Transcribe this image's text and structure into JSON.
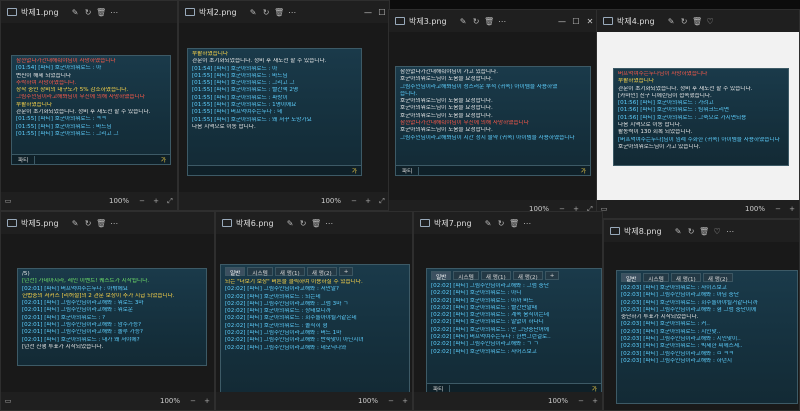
{
  "icons": [
    "photo-app-icon",
    "edit-icon",
    "rotate-icon",
    "delete-icon",
    "more-icon",
    "minimize-icon",
    "maximize-icon",
    "close-icon",
    "fit-icon",
    "zoom-out-icon",
    "zoom-in-icon",
    "fullscreen-icon",
    "heart-icon"
  ],
  "windows": [
    {
      "title": "박제1.png",
      "zoom": "100%",
      "input": "파티",
      "send": "가",
      "lines": [
        {
          "t": "잠깐없다가간대해줘야님이 사망하였습니다",
          "c": "r"
        },
        {
          "t": "[01:54] [파티] 호군아의워로드 : 아",
          "c": "c"
        },
        {
          "t": "변신이 해제 되었습니다",
          "c": "w"
        },
        {
          "t": "추락하여 사망하였습니다.",
          "c": "r"
        },
        {
          "t": "장착 중인 장비의 내구도가 5% 감소하였습니다.",
          "c": "y"
        },
        {
          "t": "그림주인님이라고해봐님이 무진에 의해 사망하였습니다",
          "c": "r"
        },
        {
          "t": "부활하였습니다",
          "c": "y"
        },
        {
          "t": "관문이 초기화되었습니다. 정비 후 재도전 할 수 있습니다.",
          "c": "w"
        },
        {
          "t": "[01:55] [파티] 호군아의워로드 : ㅋㅋ",
          "c": "c"
        },
        {
          "t": "[01:55] [파티] 호군아의워로드 : 바드님",
          "c": "c"
        },
        {
          "t": "[01:55] [파티] 호군아의워로드 : 그리고 그",
          "c": "c"
        }
      ]
    },
    {
      "title": "박제2.png",
      "zoom": "100%",
      "input": "",
      "send": "가",
      "lines": [
        {
          "t": "부활하였습니다",
          "c": "y"
        },
        {
          "t": "관문이 초기화되었습니다. 정비 후 재도전 할 수 있습니다.",
          "c": "w"
        },
        {
          "t": "[01:54] [파티] 호군아의워로드 : 아",
          "c": "c"
        },
        {
          "t": "[01:55] [파티] 호군아의워로드 : 바드님",
          "c": "c"
        },
        {
          "t": "[01:55] [파티] 호군아의워로드 : 그리고 그",
          "c": "c"
        },
        {
          "t": "[01:55] [파티] 호군아의워로드 : 빨간색 2명",
          "c": "c"
        },
        {
          "t": "[01:55] [파티] 호군아의워로드 : 파랑이",
          "c": "c"
        },
        {
          "t": "[01:55] [파티] 호군아의워로드 : 1명이에요",
          "c": "c"
        },
        {
          "t": "[01:55] [파티] 버프먹여주는누나 : 네",
          "c": "c"
        },
        {
          "t": "[01:55] [파티] 호군아의워로드 : 왜 저꾸 도망가요",
          "c": "c"
        },
        {
          "t": "다음 지역으로 이동 합니다.",
          "c": "w"
        }
      ]
    },
    {
      "title": "박제3.png",
      "zoom": "100%",
      "input": "파티",
      "send": "가",
      "lines": [
        {
          "t": "잠깐없다가간대해줘야님이 가고 있습니다.",
          "c": "w"
        },
        {
          "t": "호군아의워로드님이 도움을 요청합니다.",
          "c": "w"
        },
        {
          "t": "그림주인님이라고해봐님이 성스러운 부적 (귀속) 아이템을 사용하였",
          "c": "c"
        },
        {
          "t": "습니다.",
          "c": "c"
        },
        {
          "t": "호군아의워로드님이 도움을 요청합니다.",
          "c": "w"
        },
        {
          "t": "호군아의워로드님이 도움을 요청합니다.",
          "c": "w"
        },
        {
          "t": "호군아의워로드님이 도움을 요청합니다.",
          "c": "w"
        },
        {
          "t": "잠깐없다가간대해줘야님이 무진에 의해 사망하였습니다",
          "c": "r"
        },
        {
          "t": "호군아의워로드님이 도움을 요청합니다.",
          "c": "w"
        },
        {
          "t": "그림주인님이라고해봐님이 시간 정지 물약 (귀속) 아이템을 사용하였습니다",
          "c": "c"
        }
      ]
    },
    {
      "title": "박제4.png",
      "zoom": "100%",
      "input": "",
      "send": "",
      "lines": [
        {
          "t": "버프먹여주는누나님이 사망하였습니다",
          "c": "r"
        },
        {
          "t": "부활하였습니다",
          "c": "y"
        },
        {
          "t": "관문이 초기화되었습니다. 정비 후 재도전 할 수 있습니다.",
          "c": "w"
        },
        {
          "t": "[카마인] 친구 디에린님이 접속했습니다.",
          "c": "w"
        },
        {
          "t": "[01:56] [파티] 호군아의워로드 : 가려고",
          "c": "c"
        },
        {
          "t": "[01:56] [파티] 호군아의워로드 : 팀워크드리면",
          "c": "c"
        },
        {
          "t": "[01:56] [파티] 호군아의워로드 : 그죽으로 가시면되용",
          "c": "c"
        },
        {
          "t": "다음 지역으로 이동 합니다.",
          "c": "w"
        },
        {
          "t": "활동력이 130 회복 되었습니다.",
          "c": "w"
        },
        {
          "t": "[버프먹여주는누나]님이 임례 수화한 (귀속) 아이템을 사용하였습니다",
          "c": "c"
        },
        {
          "t": "호군아의워로드님이 가고 있습니다.",
          "c": "w"
        }
      ]
    },
    {
      "title": "박제5.png",
      "zoom": "100%",
      "input": "",
      "send": "",
      "lines": [
        {
          "t": "/5)",
          "c": "w"
        },
        {
          "t": "[던전] 가데아시라, 레인 이벤트! 퀘스트가 시작됩니다.",
          "c": "g"
        },
        {
          "t": "[02:01] [파티] 버프먹여주는누나 : 아밖에요",
          "c": "c"
        },
        {
          "t": "헌법중의 서커스 [리허설]의 2 관문 보상이 추가 지급 되었습니다.",
          "c": "y"
        },
        {
          "t": "[02:01] [파티] 그림주인님이라고해봐 : 워로드 3마",
          "c": "c"
        },
        {
          "t": "[02:01] [파티] 그림주인님이라고해봐 : 워로운",
          "c": "c"
        },
        {
          "t": "[02:01] [파티] 호군아의워로드 : ?",
          "c": "c"
        },
        {
          "t": "[02:01] [파티] 그림주인님이라고해봐 : 암수가능?",
          "c": "c"
        },
        {
          "t": "[02:01] [파티] 그림주인님이라고해봐 : 솔루 가능?",
          "c": "c"
        },
        {
          "t": "[02:01] [파티] 호군아의워로드 : 내가 왜 저야에?",
          "c": "c"
        },
        {
          "t": "[던전 진행 투표가 시작되었습니다.",
          "c": "w"
        }
      ]
    },
    {
      "title": "박제6.png",
      "zoom": "100%",
      "input": "",
      "send": "",
      "tabs": [
        "일반",
        "시스템",
        "새 앵(1)",
        "새 앵(2)",
        "+"
      ],
      "lines": [
        {
          "t": "되는 \"더보기 보상\" 버튼을 클릭하여 이용하실 수 있습니다.",
          "c": "y"
        },
        {
          "t": "[02:02] [파티] 그림주인님이라고해봐 : 저만말?",
          "c": "c"
        },
        {
          "t": "[02:02] [파티] 호군아의워로드 : 되는데",
          "c": "c"
        },
        {
          "t": "[02:02] [파티] 그림주인님이라고해봐 : 그럼 3마 ㄱ",
          "c": "c"
        },
        {
          "t": "[02:02] [파티] 호군아의워로드 : 상태보니까",
          "c": "c"
        },
        {
          "t": "[02:02] [파티] 호군아의워로드 : 회수돌아야될거같은데",
          "c": "c"
        },
        {
          "t": "[02:02] [파티] 호군아의워로드 : 솔직히 형",
          "c": "c"
        },
        {
          "t": "[02:02] [파티] 그림주인님이라고해봐 : 버드 1마",
          "c": "c"
        },
        {
          "t": "[02:02] [파티] 그림주인님이라고해봐 : 반숙맞이 아닌지녀",
          "c": "c"
        },
        {
          "t": "[02:02] [파티] 그림주인님이라고해봐 : 데모닉나와",
          "c": "c"
        }
      ]
    },
    {
      "title": "박제7.png",
      "zoom": "100%",
      "input": "파티",
      "send": "가",
      "tabs": [
        "일반",
        "시스템",
        "새 앵(1)",
        "새 앵(2)",
        "+"
      ],
      "lines": [
        {
          "t": "[02:02] [파티] 그림주인님이라고해봐 : 그럼 중단",
          "c": "c"
        },
        {
          "t": "[02:02] [파티] 호군아의워로드 : 아니",
          "c": "c"
        },
        {
          "t": "[02:02] [파티] 호군아의워로드 : 아까 바드",
          "c": "c"
        },
        {
          "t": "[02:02] [파티] 호군아의워로드 : 빨간만말때",
          "c": "c"
        },
        {
          "t": "[02:02] [파티] 호군아의워로드 : 계속 움직이는데",
          "c": "c"
        },
        {
          "t": "[02:02] [파티] 호군아의워로드 : 말없이 하다니",
          "c": "c"
        },
        {
          "t": "[02:02] [파티] 호군아의워로드 : 안 그냥중단어에",
          "c": "c"
        },
        {
          "t": "[02:02] [파티] 버프먹여주는누나 : 한번그런걸로..",
          "c": "c"
        },
        {
          "t": "[02:02] [파티] 그림주인님이라고해봐 : ㄱ ㄱ",
          "c": "c"
        },
        {
          "t": "[02:02] [파티] 호군아의워로드 : 사어즈보고",
          "c": "c"
        }
      ]
    },
    {
      "title": "박제8.png",
      "zoom": "",
      "input": "",
      "send": "",
      "tabs": [
        "일반",
        "시스템",
        "새 앵(1)",
        "새 앵(2)"
      ],
      "lines": [
        {
          "t": "[02:03] [파티] 호군아의워로드 : 사이즈보고",
          "c": "c"
        },
        {
          "t": "[02:03] [파티] 그림주인님이라고해봐 : 아님 중단",
          "c": "c"
        },
        {
          "t": "[02:03] [파티] 호군아의워로드 : 회수돌아야될거같다니까",
          "c": "c"
        },
        {
          "t": "[02:03] [파티] 그림주인님이라고해봐 : 혐 그럼 중단이에",
          "c": "c"
        },
        {
          "t": "중단하기 투표가 시작되었습니다.",
          "c": "w"
        },
        {
          "t": "[02:03] [파티] 호군아의워로드 : 커..",
          "c": "c"
        },
        {
          "t": "[02:03] [파티] 호군아의워로드 : 지인맞..",
          "c": "c"
        },
        {
          "t": "[02:03] [파티] 그림주인님이라고해봐 : 지인맞이..",
          "c": "c"
        },
        {
          "t": "[02:03] [파티] 호군아의워로드 : 빅제한 씨께스세..",
          "c": "c"
        },
        {
          "t": "[02:03] [파티] 그림주인님이라고해봐 : ㅁ ㅋㅋ",
          "c": "c"
        },
        {
          "t": "[02:03] [파티] 그림주인님이라고해봐 : 하던지",
          "c": "c"
        }
      ]
    }
  ]
}
